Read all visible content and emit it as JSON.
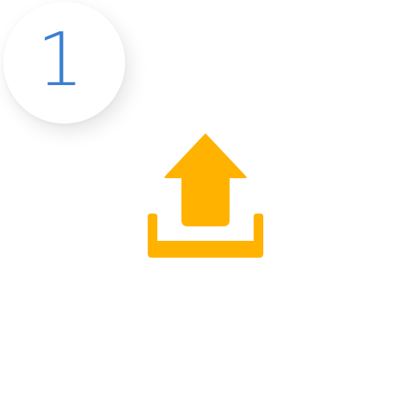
{
  "step": {
    "number": "1"
  },
  "icon": {
    "name": "upload-icon",
    "color": "#FFB300",
    "shadow_color": "#F0A800"
  },
  "colors": {
    "step_number": "#3B7FD0",
    "background": "#FFFFFF"
  }
}
